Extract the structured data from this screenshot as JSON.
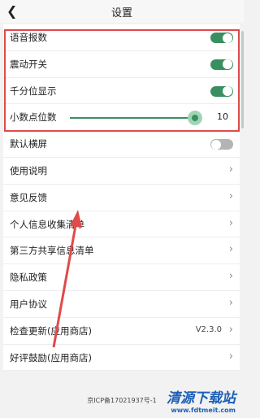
{
  "header": {
    "title": "设置"
  },
  "rows": [
    {
      "label": "语音报数",
      "control": "toggle",
      "on": true
    },
    {
      "label": "震动开关",
      "control": "toggle",
      "on": true
    },
    {
      "label": "千分位显示",
      "control": "toggle",
      "on": true
    },
    {
      "label": "小数点位数",
      "control": "slider",
      "value": "10",
      "fraction": 0.96
    },
    {
      "label": "默认横屏",
      "control": "toggle",
      "on": false
    },
    {
      "label": "使用说明",
      "control": "chevron"
    },
    {
      "label": "意见反馈",
      "control": "chevron"
    },
    {
      "label": "个人信息收集清单",
      "control": "chevron"
    },
    {
      "label": "第三方共享信息清单",
      "control": "chevron"
    },
    {
      "label": "隐私政策",
      "control": "chevron"
    },
    {
      "label": "用户协议",
      "control": "chevron"
    },
    {
      "label": "检查更新(应用商店)",
      "control": "chevron",
      "value": "V2.3.0"
    },
    {
      "label": "好评鼓励(应用商店)",
      "control": "chevron"
    }
  ],
  "footer": {
    "icp": "京ICP备17021937号-1"
  },
  "watermark": {
    "title": "清源下载站",
    "url": "www.fdtmeit.com"
  },
  "colors": {
    "accent": "#3a8f62",
    "highlight": "#e04a4a"
  }
}
